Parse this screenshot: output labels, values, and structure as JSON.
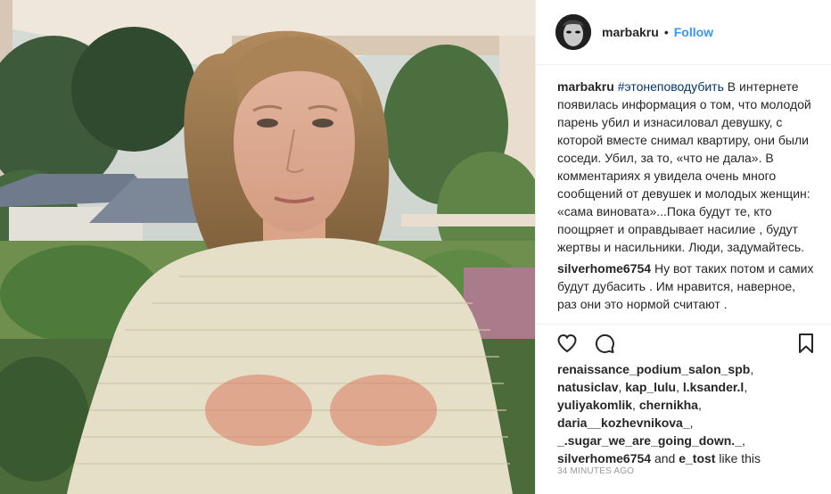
{
  "header": {
    "username": "marbakru",
    "separator": "•",
    "follow_label": "Follow"
  },
  "caption": {
    "author": "marbakru",
    "hashtag": "#этонеповодубить",
    "text": "В интернете появилась информация о том, что молодой парень убил и изнасиловал девушку, с которой вместе снимал квартиру, они были соседи. Убил, за то, «что не дала». В комментариях я увидела очень много сообщений от девушек и молодых женщин: «сама виновата»...Пока будут те, кто поощряет и оправдывает насилие , будут жертвы и насильники. Люди, задумайтесь."
  },
  "comments": [
    {
      "author": "silverhome6754",
      "text": "Ну вот таких потом и самих будут дубасить . Им нравится, наверное, раз они это нормой считают ."
    }
  ],
  "actions": {
    "like_icon": "heart-icon",
    "comment_icon": "comment-bubble-icon",
    "save_icon": "bookmark-icon"
  },
  "likes": {
    "likers": [
      "renaissance_podium_salon_spb",
      "natusiclav",
      "kap_lulu",
      "l.ksander.l",
      "yuliyakomlik",
      "chernikha",
      "daria__kozhevnikova_",
      "_.sugar_we_are_going_down._",
      "silverhome6754",
      "e_tost"
    ],
    "and_word": "and",
    "suffix": "like this"
  },
  "timestamp": "34 minutes ago",
  "colors": {
    "link_blue": "#3897f0",
    "hashtag_blue": "#003569",
    "text_dark": "#262626",
    "muted": "#999999"
  }
}
